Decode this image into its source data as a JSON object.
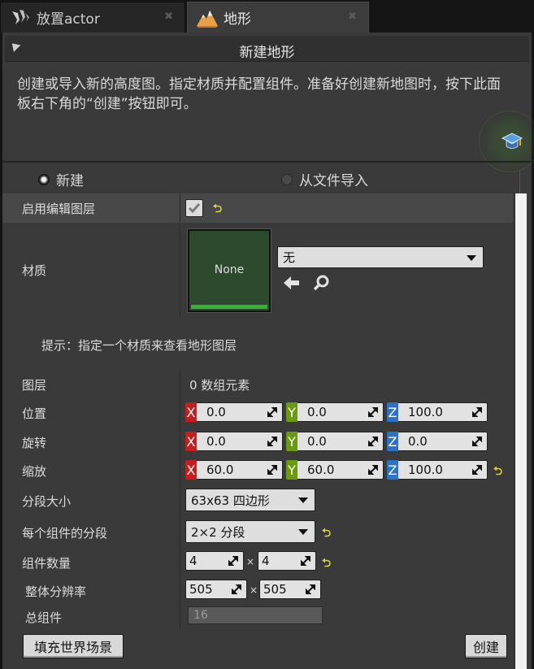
{
  "tabs": [
    {
      "label": "放置actor",
      "icon": "place-actor-icon",
      "close": "✖"
    },
    {
      "label": "地形",
      "icon": "landscape-icon",
      "close": "✖"
    }
  ],
  "panel": {
    "title": "新建地形",
    "description": "创建或导入新的高度图。指定材质并配置组件。准备好创建新地图时，按下此面板右下角的“创建”按钮即可。"
  },
  "mode": {
    "options": [
      {
        "label": "新建",
        "selected": true
      },
      {
        "label": "从文件导入",
        "selected": false
      }
    ]
  },
  "properties": {
    "enable_edit_layers": {
      "label": "启用编辑图层",
      "checked": true
    },
    "material": {
      "label": "材质",
      "thumbnail": "None",
      "value": "无",
      "hint": "提示：指定一个材质来查看地形图层"
    },
    "layers": {
      "label": "图层",
      "value": "0 数组元素"
    },
    "location": {
      "label": "位置",
      "x": "0.0",
      "y": "0.0",
      "z": "100.0"
    },
    "rotation": {
      "label": "旋转",
      "x": "0.0",
      "y": "0.0",
      "z": "0.0"
    },
    "scale": {
      "label": "缩放",
      "x": "60.0",
      "y": "60.0",
      "z": "100.0"
    },
    "section_size": {
      "label": "分段大小",
      "value": "63x63 四边形"
    },
    "sections_per_component": {
      "label": "每个组件的分段",
      "value": "2×2 分段"
    },
    "number_of_components": {
      "label": "组件数量",
      "x": "4",
      "y": "4"
    },
    "overall_resolution": {
      "label": "整体分辨率",
      "x": "505",
      "y": "505"
    },
    "total_components": {
      "label": "总组件",
      "value": "16"
    }
  },
  "axis_labels": {
    "x": "X",
    "y": "Y",
    "z": "Z"
  },
  "times_sign": "×",
  "reset_glyph": "⮌",
  "buttons": {
    "fill_world": "填充世界场景",
    "create": "创建"
  },
  "colors": {
    "axis_x": "#c41e1e",
    "axis_y": "#6a9a0f",
    "axis_z": "#2c72c8",
    "reset": "#d9d43a",
    "thumbnail_bar": "#33b233"
  }
}
